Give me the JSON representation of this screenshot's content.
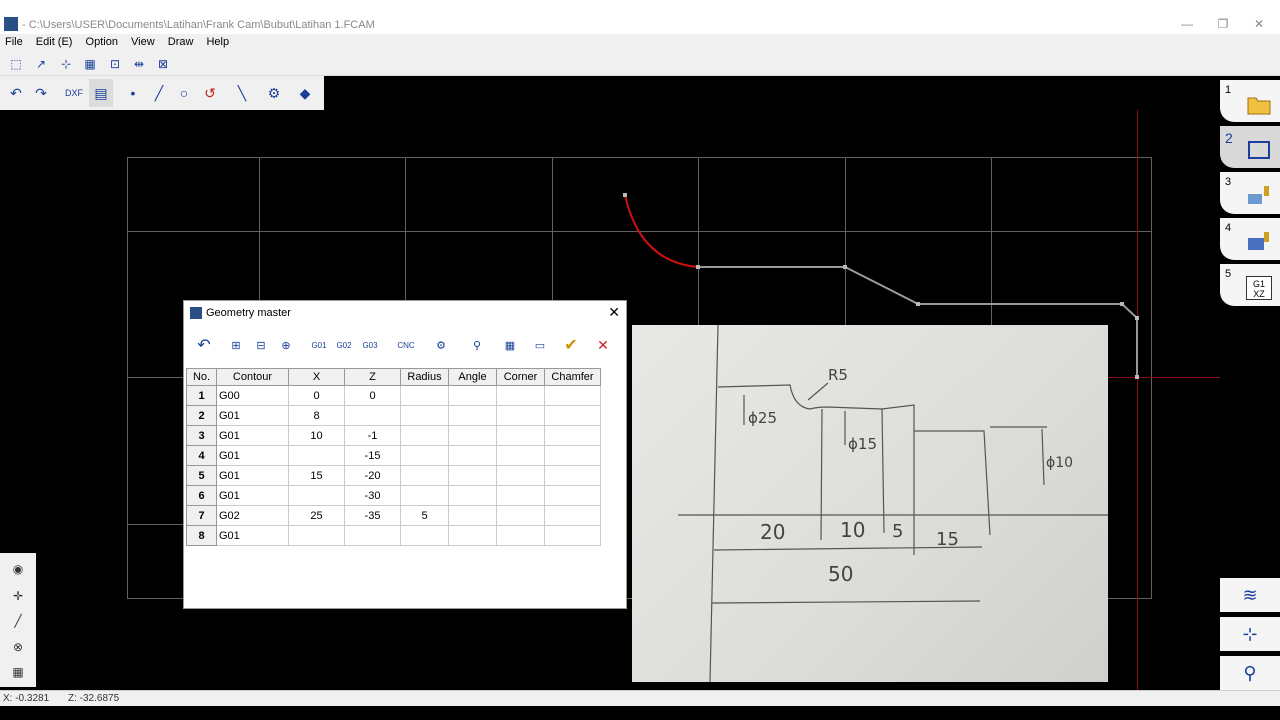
{
  "window": {
    "title": "- C:\\Users\\USER\\Documents\\Latihan\\Frank Cam\\Bubut\\Latihan 1.FCAM"
  },
  "menu": {
    "file": "File",
    "edit": "Edit (E)",
    "option": "Option",
    "view": "View",
    "draw": "Draw",
    "help": "Help"
  },
  "steps": [
    {
      "num": "1",
      "icon": "folder-icon"
    },
    {
      "num": "2",
      "icon": "geometry-icon"
    },
    {
      "num": "3",
      "icon": "tooling-icon"
    },
    {
      "num": "4",
      "icon": "machining-icon"
    },
    {
      "num": "5",
      "icon": "gcode-icon",
      "label": "G1 XZ"
    }
  ],
  "status": {
    "x": "X: -0.3281",
    "z": "Z: -32.6875"
  },
  "dialog": {
    "title": "Geometry master",
    "toolbar": {
      "g01": "G01",
      "g02": "G02",
      "g03": "G03",
      "cnc": "CNC"
    },
    "columns": [
      "No.",
      "Contour",
      "X",
      "Z",
      "Radius",
      "Angle",
      "Corner",
      "Chamfer"
    ],
    "rows": [
      {
        "no": "1",
        "contour": "G00",
        "x": "0",
        "z": "0",
        "radius": ""
      },
      {
        "no": "2",
        "contour": "G01",
        "x": "8",
        "z": "",
        "radius": ""
      },
      {
        "no": "3",
        "contour": "G01",
        "x": "10",
        "z": "-1",
        "radius": ""
      },
      {
        "no": "4",
        "contour": "G01",
        "x": "",
        "z": "-15",
        "radius": ""
      },
      {
        "no": "5",
        "contour": "G01",
        "x": "15",
        "z": "-20",
        "radius": ""
      },
      {
        "no": "6",
        "contour": "G01",
        "x": "",
        "z": "-30",
        "radius": ""
      },
      {
        "no": "7",
        "contour": "G02",
        "x": "25",
        "z": "-35",
        "radius": "5"
      },
      {
        "no": "8",
        "contour": "G01",
        "x": "",
        "z": "",
        "radius": ""
      }
    ]
  },
  "sketch": {
    "r5": "R5",
    "d25": "ϕ25",
    "d15": "ϕ15",
    "d10": "ϕ10",
    "dim20": "20",
    "dim10": "10",
    "dim5": "5",
    "dim15": "15",
    "dim50": "50"
  },
  "colors": {
    "canvas": "#000000",
    "contour": "#9a9a9a",
    "arc": "#d01010",
    "grid": "#606060"
  }
}
